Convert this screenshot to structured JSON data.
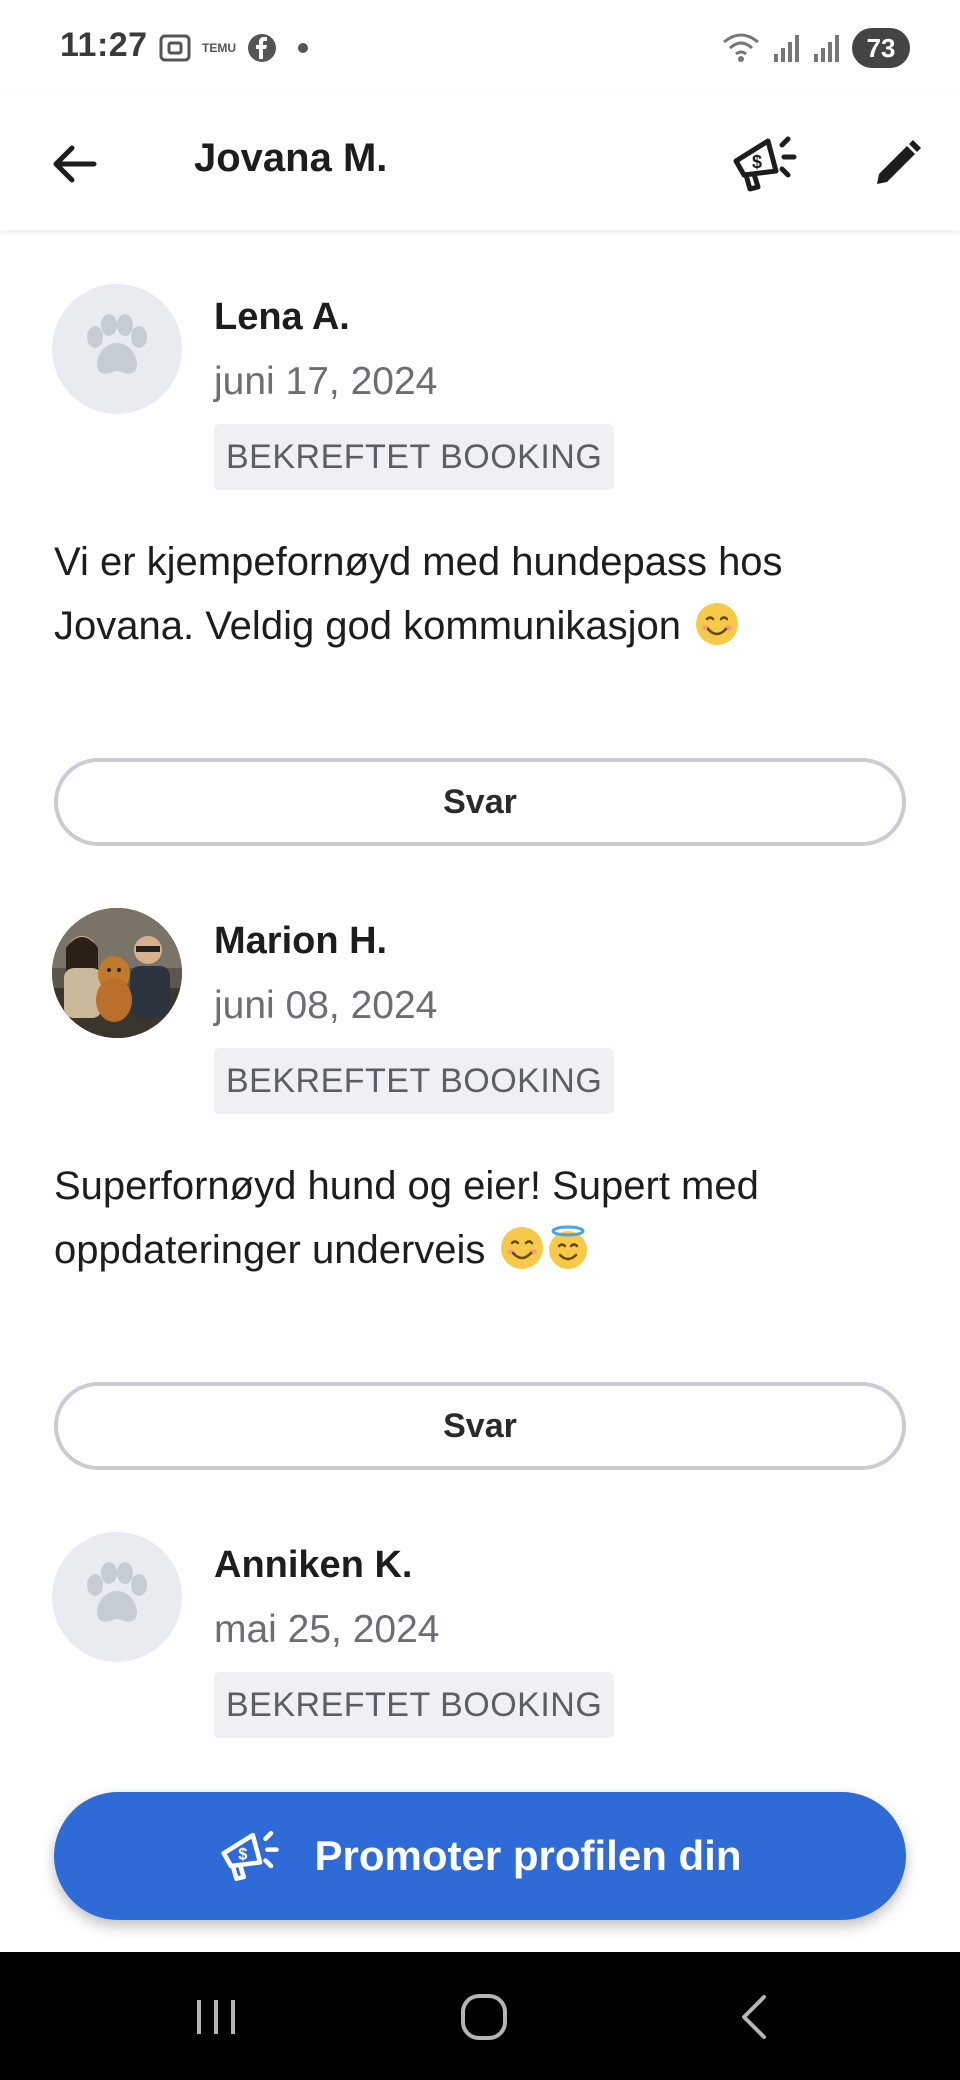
{
  "status_bar": {
    "time": "11:27",
    "battery": "73",
    "temu_label": "TEMU"
  },
  "app_bar": {
    "title": "Jovana M."
  },
  "reviews": [
    {
      "name": "Lena A.",
      "date": "juni 17, 2024",
      "badge": "BEKREFTET BOOKING",
      "text": "Vi er kjempefornøyd med hundepass hos Jovana. Veldig god kommunikasjon",
      "emojis": [
        "smiling-face"
      ],
      "avatar": "paw-placeholder",
      "reply_label": "Svar"
    },
    {
      "name": "Marion H.",
      "date": "juni 08, 2024",
      "badge": "BEKREFTET BOOKING",
      "text": "Superfornøyd hund og eier! Supert med oppdateringer underveis",
      "emojis": [
        "smiling-face",
        "smiling-face-with-halo"
      ],
      "avatar": "photo",
      "reply_label": "Svar"
    },
    {
      "name": "Anniken K.",
      "date": "mai 25, 2024",
      "badge": "BEKREFTET BOOKING",
      "avatar": "paw-placeholder"
    }
  ],
  "promote_button": {
    "label": "Promoter profilen din"
  },
  "colors": {
    "accent": "#2f6bd6",
    "badge_bg": "#eef0f3",
    "avatar_bg": "#e8ecf0",
    "date_text": "#6b6f75"
  }
}
